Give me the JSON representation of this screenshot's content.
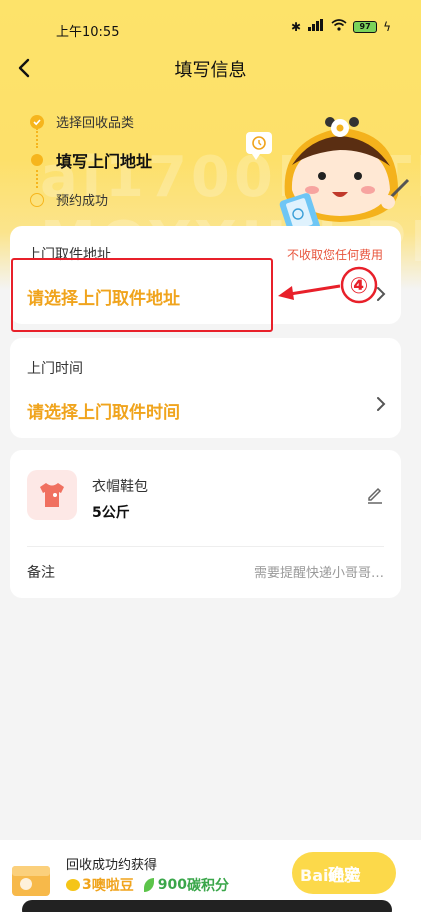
{
  "status_bar": {
    "time": "上午10:55",
    "icons": [
      "bluetooth-icon",
      "signal-icon",
      "wifi-icon"
    ],
    "battery": "97"
  },
  "navbar": {
    "title": "填写信息"
  },
  "steps": [
    {
      "label": "选择回收品类",
      "state": "done"
    },
    {
      "label": "填写上门地址",
      "state": "current"
    },
    {
      "label": "预约成功",
      "state": "todo"
    }
  ],
  "address_card": {
    "label": "上门取件地址",
    "free_tag": "不收取您任何费用",
    "value": "请选择上门取件地址"
  },
  "annotation": {
    "number": "④"
  },
  "time_card": {
    "label": "上门时间",
    "value": "请选择上门取件时间"
  },
  "item_card": {
    "name": "衣帽鞋包",
    "weight": "5公斤",
    "note_label": "备注",
    "note_value": "需要提醒快递小哥哥…"
  },
  "bottom_bar": {
    "reward_title": "回收成功约获得",
    "coin_amount": "3",
    "coin_unit": "噢啦豆",
    "points_amount": "900",
    "points_unit": "碳积分",
    "confirm_label": "确定",
    "watermark": "Bai经验"
  },
  "colors": {
    "accent": "#f0a41d",
    "hero_yellow": "#fde36a",
    "annotation_red": "#e8202a",
    "button_yellow": "#fcd94a"
  }
}
